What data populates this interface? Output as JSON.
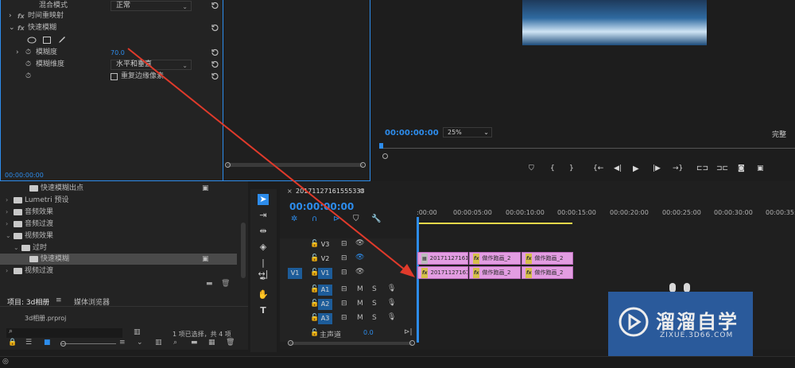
{
  "effect_controls": {
    "rows": [
      {
        "label": "混合模式",
        "value": "正常"
      },
      {
        "label": "时间重映射"
      },
      {
        "label": "快速模糊"
      },
      {
        "label": "模糊度",
        "value": "70.0"
      },
      {
        "label": "模糊维度",
        "value": "水平和垂直"
      },
      {
        "label": "重复边缘像素"
      }
    ],
    "fx": "fx",
    "timecode": "00:00:00:00"
  },
  "program": {
    "timecode": "00:00:00:00",
    "zoom": "25%",
    "quality": "完整"
  },
  "project_panel": {
    "tree": [
      {
        "label": "快速模糊出点",
        "indent": 2
      },
      {
        "label": "Lumetri 预设",
        "indent": 0
      },
      {
        "label": "音频效果",
        "indent": 0
      },
      {
        "label": "音频过渡",
        "indent": 0
      },
      {
        "label": "视频效果",
        "indent": 0
      },
      {
        "label": "过时",
        "indent": 1
      },
      {
        "label": "快速模糊",
        "indent": 2
      },
      {
        "label": "视频过渡",
        "indent": 0
      }
    ],
    "tab_project": "项目: 3d相册",
    "tab_media": "媒体浏览器",
    "project_file": "3d相册.prproj",
    "selection_status": "1 项已选择，共 4 项"
  },
  "timeline": {
    "sequence_name": "20171127161555333",
    "timecode": "00:00:00:00",
    "ruler": [
      ":00:00",
      "00:00:05:00",
      "00:00:10:00",
      "00:00:15:00",
      "00:00:20:00",
      "00:00:25:00",
      "00:00:30:00",
      "00:00:35:0"
    ],
    "tracks": {
      "v3": "V3",
      "v2": "V2",
      "v1": "V1",
      "v1_src": "V1",
      "a1": "A1",
      "a2": "A2",
      "a3": "A3",
      "m": "M",
      "s": "S"
    },
    "master": {
      "label": "主声道",
      "value": "0.0"
    },
    "clips": {
      "v2": [
        "20171127161",
        "做作跑画_2",
        "做作跑画_2"
      ],
      "v1": [
        "20171127161",
        "做作跑画_2",
        "做作跑画_2"
      ]
    }
  },
  "watermark": {
    "name": "溜溜自学",
    "url": "ZIXUE.3D66.COM"
  }
}
